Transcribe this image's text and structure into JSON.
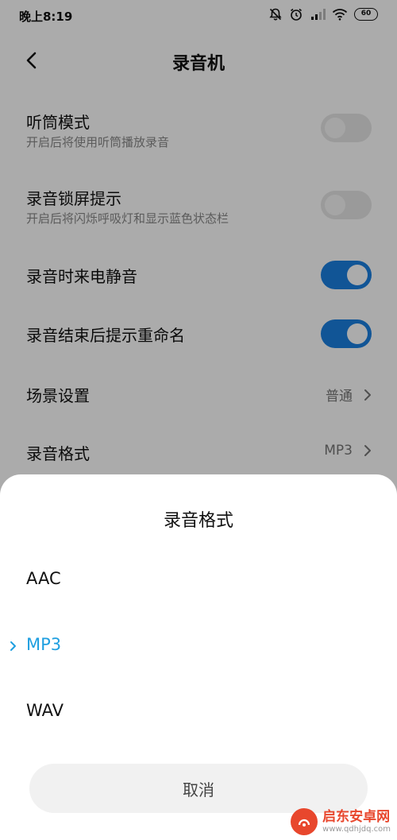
{
  "status_bar": {
    "time": "晚上8:19",
    "battery": "60"
  },
  "header": {
    "title": "录音机"
  },
  "settings": [
    {
      "title": "听筒模式",
      "subtitle": "开启后将使用听筒播放录音",
      "toggle_on": false
    },
    {
      "title": "录音锁屏提示",
      "subtitle": "开启后将闪烁呼吸灯和显示蓝色状态栏",
      "toggle_on": false
    },
    {
      "title": "录音时来电静音",
      "toggle_on": true
    },
    {
      "title": "录音结束后提示重命名",
      "toggle_on": true
    },
    {
      "title": "场景设置",
      "value": "普通"
    },
    {
      "title": "录音格式",
      "value": "MP3"
    }
  ],
  "sheet": {
    "title": "录音格式",
    "options": [
      {
        "label": "AAC",
        "selected": false
      },
      {
        "label": "MP3",
        "selected": true
      },
      {
        "label": "WAV",
        "selected": false
      }
    ],
    "cancel_label": "取消"
  },
  "watermark": {
    "name": "启东安卓网",
    "url": "www.qdhjdq.com"
  },
  "colors": {
    "accent_toggle": "#1a7fe0",
    "selected_option": "#1f9fe0",
    "watermark": "#e8472d"
  }
}
